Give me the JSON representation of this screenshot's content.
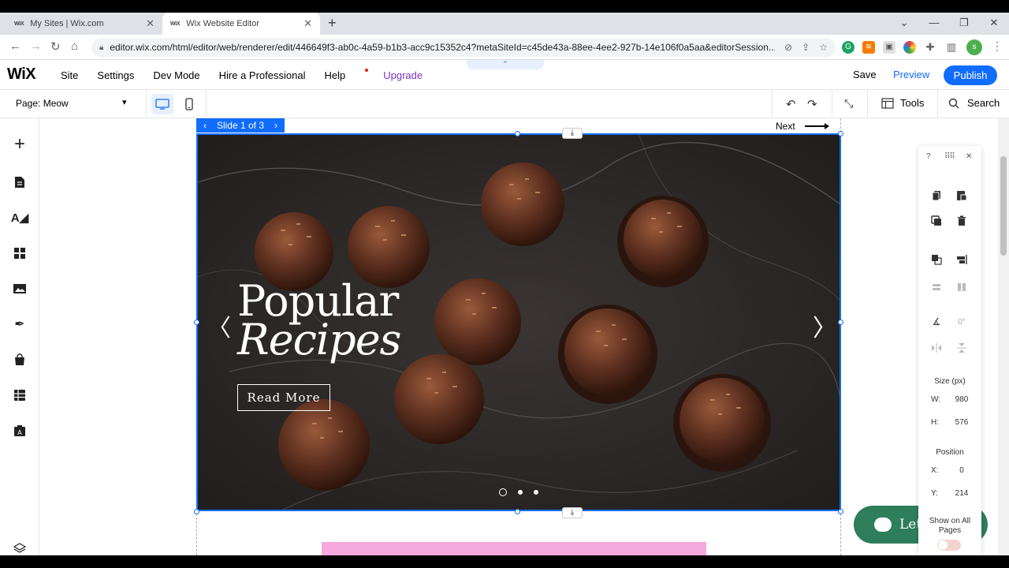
{
  "browser": {
    "tabs": [
      {
        "favicon": "WiX",
        "title": "My Sites | Wix.com"
      },
      {
        "favicon": "WiX",
        "title": "Wix Website Editor"
      }
    ],
    "url": "editor.wix.com/html/editor/web/renderer/edit/446649f3-ab0c-4a59-b1b3-acc9c15352c4?metaSiteId=c45de43a-88ee-4ee2-927b-14e106f0a5aa&editorSession...",
    "profile_initial": "s"
  },
  "editor": {
    "logo": "WiX",
    "menu": [
      "Site",
      "Settings",
      "Dev Mode",
      "Hire a Professional",
      "Help"
    ],
    "upgrade": "Upgrade",
    "save": "Save",
    "preview": "Preview",
    "publish": "Publish",
    "page_selector": "Page: Meow",
    "tools": "Tools",
    "search": "Search"
  },
  "slideshow": {
    "slide_label": "Slide 1 of 3",
    "next_label": "Next",
    "title_line1": "Popular",
    "title_line2": "Recipes",
    "button": "Read More",
    "slide_count": 3,
    "current_slide": 1
  },
  "chat": {
    "label": "Let"
  },
  "side_panel": {
    "help": "?",
    "rotation": "0°",
    "size_label": "Size (px)",
    "width_key": "W:",
    "width": "980",
    "height_key": "H:",
    "height": "576",
    "position_label": "Position",
    "x_key": "X:",
    "x": "0",
    "y_key": "Y:",
    "y": "214",
    "show_all_pages": "Show on All Pages"
  },
  "colors": {
    "accent": "#116dff",
    "upgrade": "#7a35c5",
    "chat": "#2e7d5b",
    "pink_strip": "#f5a9df"
  }
}
